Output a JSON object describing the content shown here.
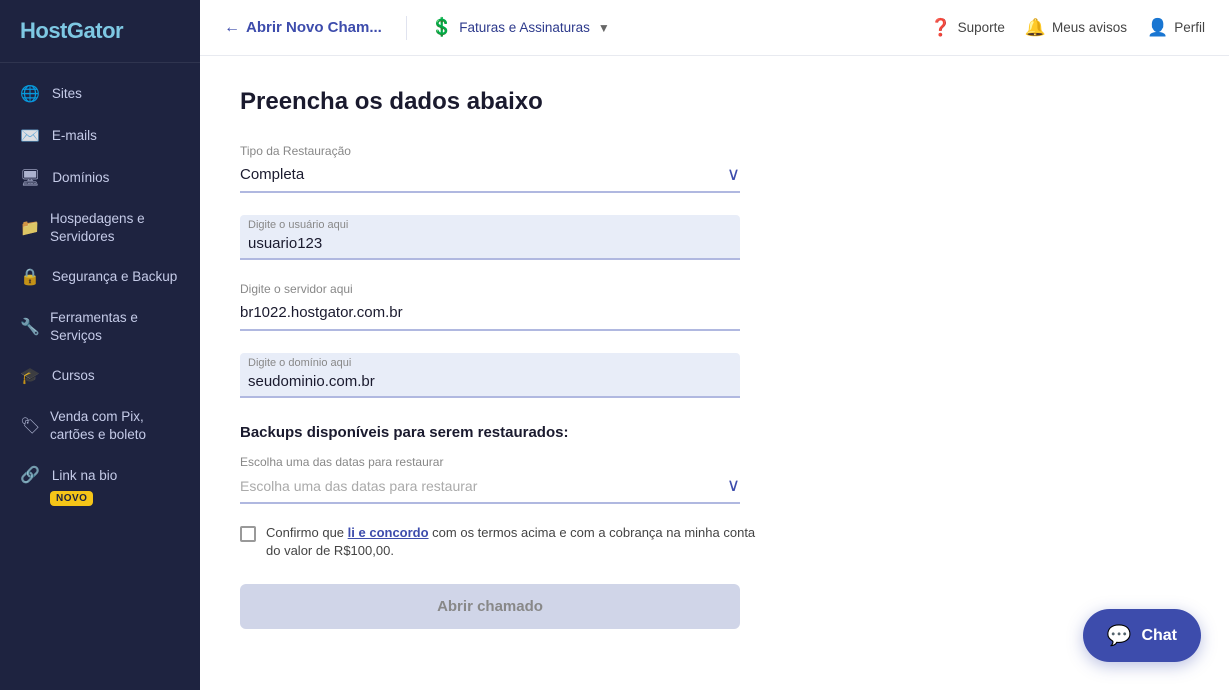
{
  "brand": {
    "name_part1": "Host",
    "name_part2": "Gator"
  },
  "sidebar": {
    "items": [
      {
        "id": "sites",
        "label": "Sites",
        "icon": "🌐"
      },
      {
        "id": "emails",
        "label": "E-mails",
        "icon": "✉️"
      },
      {
        "id": "dominios",
        "label": "Domínios",
        "icon": "🖥"
      },
      {
        "id": "hospedagens",
        "label": "Hospedagens e Servidores",
        "icon": "📁"
      },
      {
        "id": "seguranca",
        "label": "Segurança e Backup",
        "icon": "🔒"
      },
      {
        "id": "ferramentas",
        "label": "Ferramentas e Serviços",
        "icon": "🔧"
      },
      {
        "id": "cursos",
        "label": "Cursos",
        "icon": "🎓"
      },
      {
        "id": "venda",
        "label": "Venda com Pix, cartões e boleto",
        "icon": "🏷"
      }
    ],
    "link_bio": {
      "label": "Link na bio",
      "badge": "NOVO"
    }
  },
  "topbar": {
    "back_label": "Abrir Novo Cham...",
    "faturas_label": "Faturas e Assinaturas",
    "suporte_label": "Suporte",
    "avisos_label": "Meus avisos",
    "perfil_label": "Perfil"
  },
  "form": {
    "page_title": "Preencha os dados abaixo",
    "tipo_label": "Tipo da Restauração",
    "tipo_value": "Completa",
    "usuario_label": "Digite o usuário aqui",
    "usuario_value": "usuario123",
    "servidor_label": "Digite o servidor aqui",
    "servidor_value": "br1022.hostgator.com.br",
    "dominio_label": "Digite o domínio aqui",
    "dominio_value": "seudominio.com.br",
    "backups_title": "Backups disponíveis para serem restaurados:",
    "data_label": "Escolha uma das datas para restaurar",
    "data_placeholder": "Escolha uma das datas para restaurar",
    "confirm_text_before": "Confirmo que ",
    "confirm_link": "li e concordo",
    "confirm_text_middle": " com os termos acima e com a cobrança na minha conta do valor de R$100,00.",
    "submit_label": "Abrir chamado"
  },
  "chat": {
    "label": "Chat",
    "icon": "💬"
  }
}
